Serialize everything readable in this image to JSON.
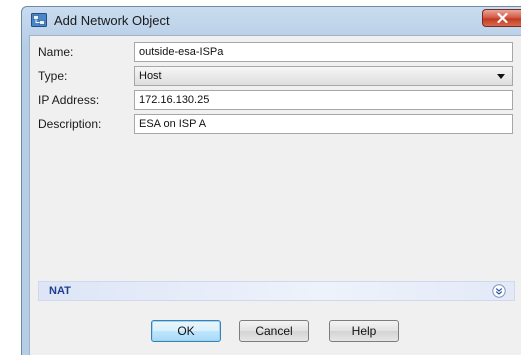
{
  "window": {
    "title": "Add Network Object",
    "title_icon": "network-object-icon",
    "close_icon": "close-icon"
  },
  "form": {
    "name": {
      "label": "Name:",
      "value": "outside-esa-ISPa"
    },
    "type": {
      "label": "Type:",
      "value": "Host"
    },
    "ip_address": {
      "label": "IP Address:",
      "value": "172.16.130.25"
    },
    "description": {
      "label": "Description:",
      "value": "ESA on ISP A"
    }
  },
  "nat": {
    "label": "NAT",
    "expand_icon": "expand-chevron-icon"
  },
  "buttons": {
    "ok": "OK",
    "cancel": "Cancel",
    "help": "Help"
  },
  "colors": {
    "titlebar": "#b6cde6",
    "close_button": "#c23a23",
    "nat_label": "#1e3f91",
    "dialog_background": "#f0f0f0"
  }
}
